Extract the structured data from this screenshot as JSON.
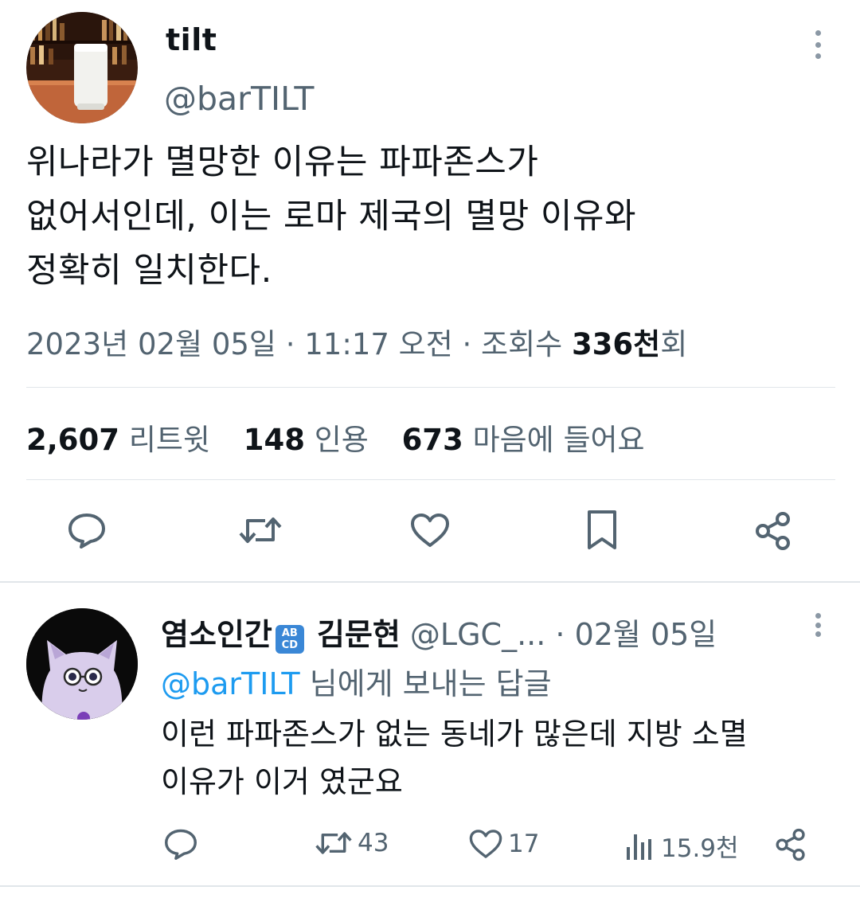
{
  "tweet": {
    "display_name": "tilt",
    "handle": "@barTILT",
    "text": "위나라가 멸망한 이유는 파파존스가\n없어서인데, 이는 로마 제국의 멸망 이유와\n정확히 일치한다.",
    "date": "2023년 02월 05일",
    "sep1": " · ",
    "time": "11:17 오전",
    "sep2": " · ",
    "views_label_prefix": "조회수 ",
    "views_count": "336천",
    "views_label_suffix": "회",
    "stats": {
      "retweets_count": "2,607",
      "retweets_label": "리트윗",
      "quotes_count": "148",
      "quotes_label": "인용",
      "likes_count": "673",
      "likes_label": "마음에 들어요"
    },
    "actions": [
      "reply-icon",
      "retweet-icon",
      "like-icon",
      "bookmark-icon",
      "share-icon"
    ]
  },
  "reply": {
    "display_name_1": "염소인간",
    "emoji_text": "🔠",
    "display_name_2": "김문현",
    "handle": "@LGC_...",
    "sep": " · ",
    "date": "02월 05일",
    "reply_to_mention": "@barTILT",
    "reply_to_suffix": " 님에게 보내는 답글",
    "text": "이런 파파존스가 없는 동네가 많은데 지방 소멸\n이유가 이거 였군요",
    "retweet_count": "43",
    "like_count": "17",
    "views_count": "15.9천"
  },
  "colors": {
    "text": "#0f1419",
    "secondary": "#536471",
    "link": "#1d9bf0",
    "divider": "#e1e6ea"
  }
}
